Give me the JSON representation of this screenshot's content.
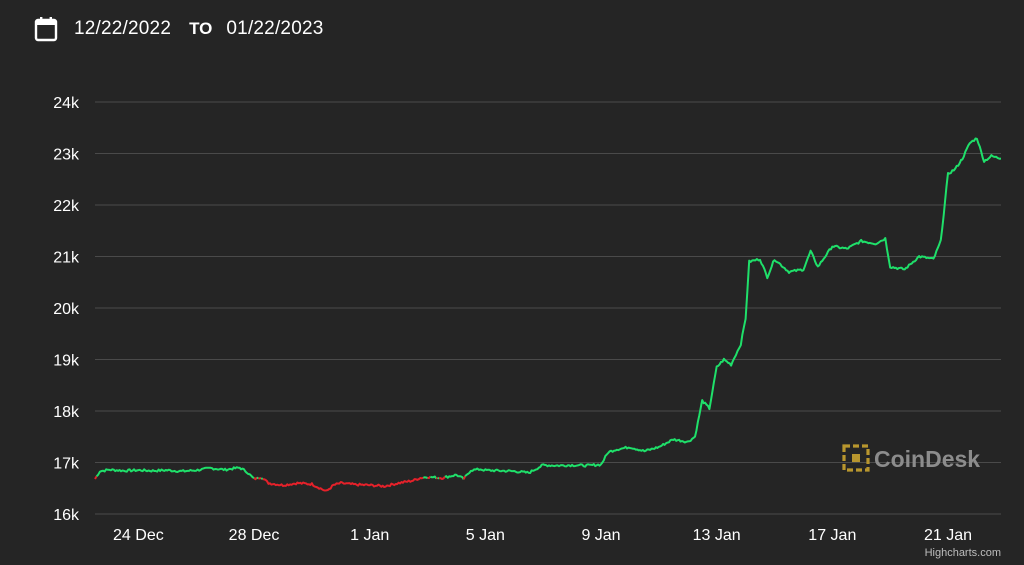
{
  "date_range": {
    "start": "12/22/2022",
    "separator": "TO",
    "end": "01/22/2023",
    "icon": "calendar-icon"
  },
  "watermark": {
    "text": "CoinDesk",
    "icon": "coindesk-logo-icon",
    "color": "#8c8c8c",
    "accent": "#b8962e"
  },
  "credits": "Highcharts.com",
  "colors": {
    "background": "#252525",
    "gridline": "#4a4a4a",
    "up": "#1fe06a",
    "down": "#e5212a"
  },
  "chart_data": {
    "type": "line",
    "title": "",
    "xlabel": "",
    "ylabel": "",
    "ylim": [
      16000,
      24000
    ],
    "yticks": [
      16000,
      17000,
      18000,
      19000,
      20000,
      21000,
      22000,
      23000,
      24000
    ],
    "ytick_labels": [
      "16k",
      "17k",
      "18k",
      "19k",
      "20k",
      "21k",
      "22k",
      "23k",
      "24k"
    ],
    "xlim": [
      "2022-12-22T12:00",
      "2023-01-22T20:00"
    ],
    "xticks": [
      "2022-12-24",
      "2022-12-28",
      "2023-01-01",
      "2023-01-05",
      "2023-01-09",
      "2023-01-13",
      "2023-01-17",
      "2023-01-21"
    ],
    "xtick_labels": [
      "24 Dec",
      "28 Dec",
      "1 Jan",
      "5 Jan",
      "9 Jan",
      "13 Jan",
      "17 Jan",
      "21 Jan"
    ],
    "grid": true,
    "legend": "none",
    "series": [
      {
        "baseline": 16700,
        "points": [
          [
            "2022-12-22T12:00",
            16680
          ],
          [
            "2022-12-22T16:00",
            16830
          ],
          [
            "2022-12-23T00:00",
            16860
          ],
          [
            "2022-12-23T12:00",
            16840
          ],
          [
            "2022-12-24T00:00",
            16850
          ],
          [
            "2022-12-24T12:00",
            16840
          ],
          [
            "2022-12-25T00:00",
            16850
          ],
          [
            "2022-12-25T12:00",
            16830
          ],
          [
            "2022-12-26T00:00",
            16850
          ],
          [
            "2022-12-26T12:00",
            16890
          ],
          [
            "2022-12-27T00:00",
            16860
          ],
          [
            "2022-12-27T12:00",
            16900
          ],
          [
            "2022-12-27T18:00",
            16820
          ],
          [
            "2022-12-28T00:00",
            16680
          ],
          [
            "2022-12-28T06:00",
            16720
          ],
          [
            "2022-12-28T12:00",
            16600
          ],
          [
            "2022-12-29T00:00",
            16560
          ],
          [
            "2022-12-29T12:00",
            16600
          ],
          [
            "2022-12-30T00:00",
            16580
          ],
          [
            "2022-12-30T12:00",
            16440
          ],
          [
            "2022-12-30T18:00",
            16560
          ],
          [
            "2022-12-31T00:00",
            16600
          ],
          [
            "2022-12-31T12:00",
            16570
          ],
          [
            "2023-01-01T00:00",
            16560
          ],
          [
            "2023-01-01T12:00",
            16540
          ],
          [
            "2023-01-02T00:00",
            16600
          ],
          [
            "2023-01-02T12:00",
            16650
          ],
          [
            "2023-01-02T18:00",
            16700
          ],
          [
            "2023-01-03T00:00",
            16720
          ],
          [
            "2023-01-03T12:00",
            16700
          ],
          [
            "2023-01-04T00:00",
            16760
          ],
          [
            "2023-01-04T06:00",
            16680
          ],
          [
            "2023-01-04T12:00",
            16850
          ],
          [
            "2023-01-04T20:00",
            16870
          ],
          [
            "2023-01-05T00:00",
            16850
          ],
          [
            "2023-01-05T12:00",
            16840
          ],
          [
            "2023-01-06T00:00",
            16830
          ],
          [
            "2023-01-06T12:00",
            16800
          ],
          [
            "2023-01-07T00:00",
            16950
          ],
          [
            "2023-01-07T12:00",
            16940
          ],
          [
            "2023-01-08T00:00",
            16950
          ],
          [
            "2023-01-08T12:00",
            16940
          ],
          [
            "2023-01-09T00:00",
            16960
          ],
          [
            "2023-01-09T06:00",
            17200
          ],
          [
            "2023-01-09T12:00",
            17250
          ],
          [
            "2023-01-10T00:00",
            17300
          ],
          [
            "2023-01-10T12:00",
            17220
          ],
          [
            "2023-01-11T00:00",
            17300
          ],
          [
            "2023-01-11T12:00",
            17450
          ],
          [
            "2023-01-12T00:00",
            17400
          ],
          [
            "2023-01-12T06:00",
            17500
          ],
          [
            "2023-01-12T12:00",
            18200
          ],
          [
            "2023-01-12T18:00",
            18050
          ],
          [
            "2023-01-13T00:00",
            18850
          ],
          [
            "2023-01-13T06:00",
            19000
          ],
          [
            "2023-01-13T12:00",
            18900
          ],
          [
            "2023-01-13T20:00",
            19300
          ],
          [
            "2023-01-14T00:00",
            19800
          ],
          [
            "2023-01-14T03:00",
            20900
          ],
          [
            "2023-01-14T12:00",
            20950
          ],
          [
            "2023-01-14T18:00",
            20600
          ],
          [
            "2023-01-15T00:00",
            20950
          ],
          [
            "2023-01-15T12:00",
            20700
          ],
          [
            "2023-01-16T00:00",
            20750
          ],
          [
            "2023-01-16T06:00",
            21100
          ],
          [
            "2023-01-16T12:00",
            20800
          ],
          [
            "2023-01-17T00:00",
            21200
          ],
          [
            "2023-01-17T12:00",
            21150
          ],
          [
            "2023-01-18T00:00",
            21300
          ],
          [
            "2023-01-18T12:00",
            21250
          ],
          [
            "2023-01-18T20:00",
            21350
          ],
          [
            "2023-01-19T00:00",
            20800
          ],
          [
            "2023-01-19T12:00",
            20750
          ],
          [
            "2023-01-20T00:00",
            21000
          ],
          [
            "2023-01-20T12:00",
            20950
          ],
          [
            "2023-01-20T18:00",
            21300
          ],
          [
            "2023-01-21T00:00",
            22600
          ],
          [
            "2023-01-21T06:00",
            22700
          ],
          [
            "2023-01-21T12:00",
            22900
          ],
          [
            "2023-01-21T18:00",
            23200
          ],
          [
            "2023-01-22T00:00",
            23300
          ],
          [
            "2023-01-22T06:00",
            22850
          ],
          [
            "2023-01-22T12:00",
            22950
          ],
          [
            "2023-01-22T20:00",
            22900
          ]
        ]
      }
    ]
  }
}
